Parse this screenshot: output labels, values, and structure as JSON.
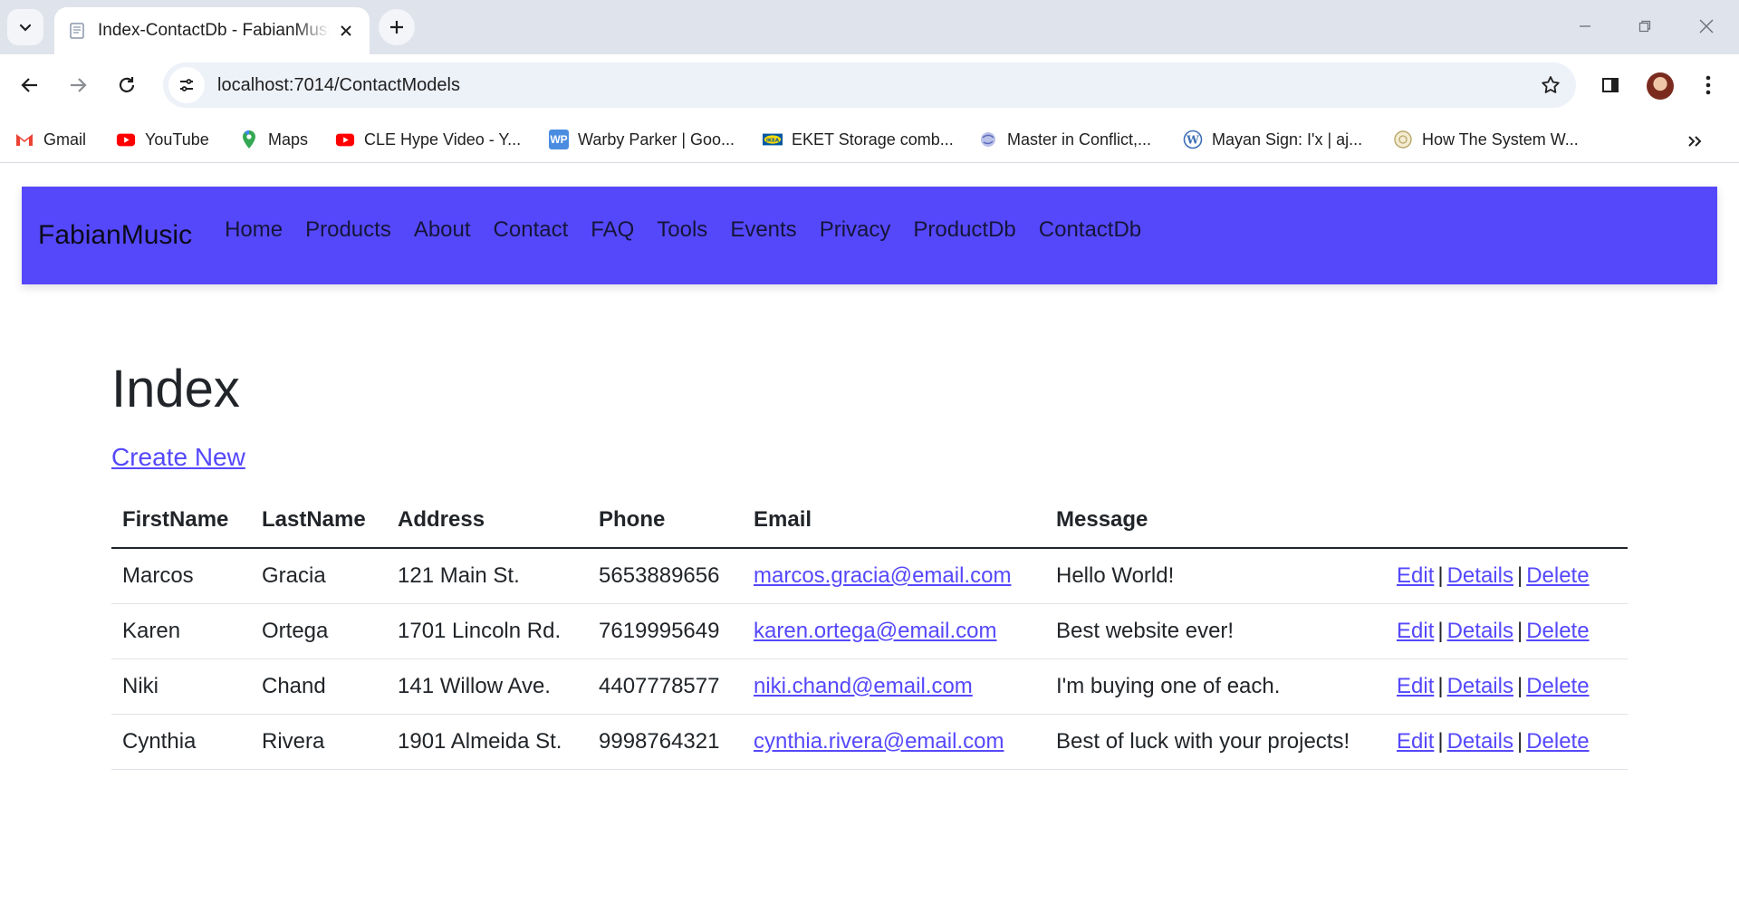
{
  "browser": {
    "tab": {
      "title": "Index-ContactDb - FabianMusic"
    },
    "url": "localhost:7014/ContactModels",
    "bookmarks": [
      {
        "label": "Gmail",
        "icon": "gmail-icon"
      },
      {
        "label": "YouTube",
        "icon": "youtube-icon"
      },
      {
        "label": "Maps",
        "icon": "maps-icon"
      },
      {
        "label": "CLE Hype Video - Y...",
        "icon": "youtube-icon"
      },
      {
        "label": "Warby Parker | Goo...",
        "icon": "wp-icon"
      },
      {
        "label": "EKET Storage comb...",
        "icon": "ikea-icon"
      },
      {
        "label": "Master in Conflict,...",
        "icon": "site-icon"
      },
      {
        "label": "Mayan Sign: I'x | aj...",
        "icon": "wordpress-icon"
      },
      {
        "label": "How The System W...",
        "icon": "site-icon"
      }
    ]
  },
  "site": {
    "brand": "FabianMusic",
    "nav": [
      "Home",
      "Products",
      "About",
      "Contact",
      "FAQ",
      "Tools",
      "Events",
      "Privacy",
      "ProductDb",
      "ContactDb"
    ],
    "accent_color": "#5548fb"
  },
  "main": {
    "heading": "Index",
    "create_link": "Create New",
    "columns": [
      "FirstName",
      "LastName",
      "Address",
      "Phone",
      "Email",
      "Message"
    ],
    "rows": [
      {
        "first": "Marcos",
        "last": "Gracia",
        "address": "121 Main St.",
        "phone": "5653889656",
        "email": "marcos.gracia@email.com",
        "message": "Hello World!"
      },
      {
        "first": "Karen",
        "last": "Ortega",
        "address": "1701 Lincoln Rd.",
        "phone": "7619995649",
        "email": "karen.ortega@email.com",
        "message": "Best website ever!"
      },
      {
        "first": "Niki",
        "last": "Chand",
        "address": "141 Willow Ave.",
        "phone": "4407778577",
        "email": "niki.chand@email.com",
        "message": "I'm buying one of each."
      },
      {
        "first": "Cynthia",
        "last": "Rivera",
        "address": "1901 Almeida St.",
        "phone": "9998764321",
        "email": "cynthia.rivera@email.com",
        "message": "Best of luck with your projects!"
      }
    ],
    "actions": {
      "edit": "Edit",
      "details": "Details",
      "delete": "Delete",
      "separator": "|"
    }
  }
}
